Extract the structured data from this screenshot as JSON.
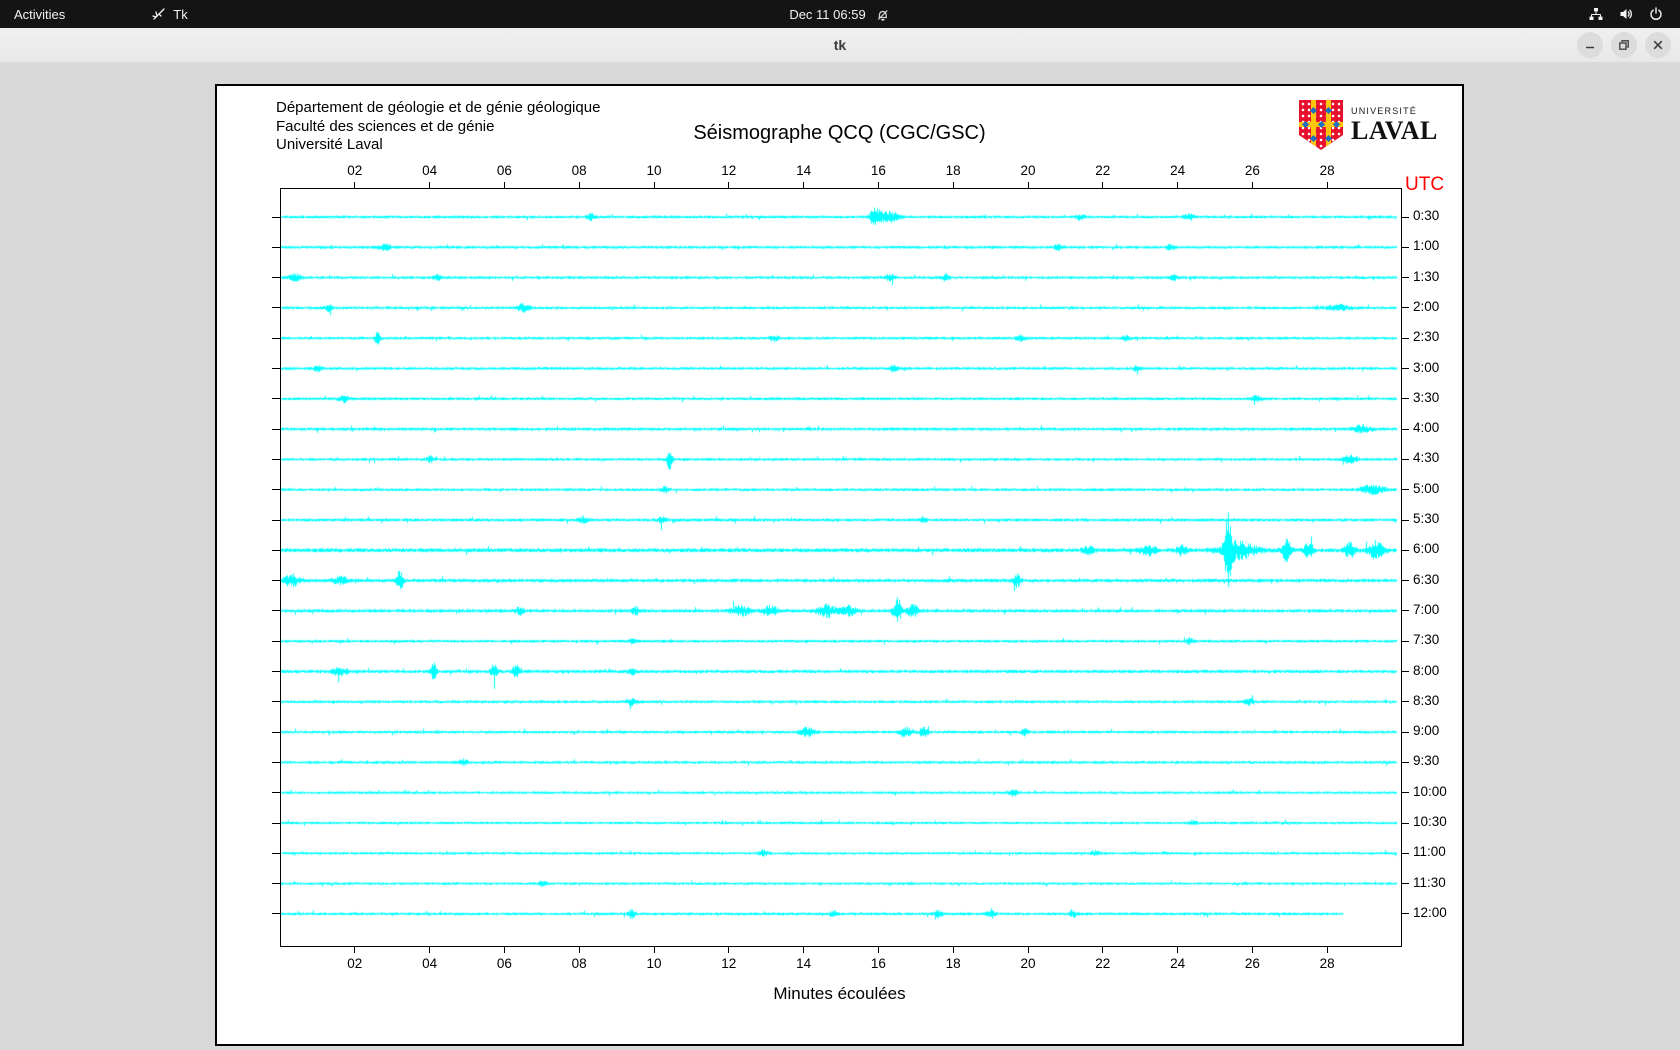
{
  "topbar": {
    "activities": "Activities",
    "app_label": "Tk",
    "clock": "Dec 11  06:59",
    "icons": [
      "tk-icon",
      "bell-muted-icon",
      "network-wired-icon",
      "volume-icon",
      "power-icon"
    ]
  },
  "titlebar": {
    "title": "tk",
    "buttons": [
      "minimize",
      "restore",
      "close"
    ]
  },
  "seismograph": {
    "org_lines": [
      "Département de géologie et de génie géologique",
      "Faculté des sciences et de génie",
      "Université Laval"
    ],
    "title": "Séismographe QCQ (CGC/GSC)",
    "logo": {
      "univ": "UNIVERSITÉ",
      "laval": "LAVAL"
    },
    "utc_label": "UTC",
    "xlabel": "Minutes écoulées",
    "chart_data": {
      "type": "line",
      "subtype": "seismogram-helicorder",
      "trace_color": "#00ffff",
      "x_range_minutes": [
        0,
        30
      ],
      "x_ticks": {
        "minutes": [
          2,
          4,
          6,
          8,
          10,
          12,
          14,
          16,
          18,
          20,
          22,
          24,
          26,
          28
        ],
        "labels": [
          "02",
          "04",
          "06",
          "08",
          "10",
          "12",
          "14",
          "16",
          "18",
          "20",
          "22",
          "24",
          "26",
          "28"
        ]
      },
      "rows": [
        {
          "label": "0:30",
          "base": 1.2,
          "events": [
            {
              "m": 15.9,
              "a": 7,
              "w": 0.12
            },
            {
              "m": 16.2,
              "a": 5,
              "w": 0.3
            },
            {
              "m": 8.3,
              "a": 2.5,
              "w": 0.1
            },
            {
              "m": 21.4,
              "a": 2.5,
              "w": 0.1
            },
            {
              "m": 24.3,
              "a": 2.5,
              "w": 0.12
            }
          ]
        },
        {
          "label": "1:00",
          "base": 1.2,
          "events": [
            {
              "m": 2.8,
              "a": 2.5,
              "w": 0.15
            },
            {
              "m": 20.8,
              "a": 2.5,
              "w": 0.12
            },
            {
              "m": 23.8,
              "a": 2,
              "w": 0.1
            }
          ]
        },
        {
          "label": "1:30",
          "base": 1.2,
          "events": [
            {
              "m": 0.4,
              "a": 3,
              "w": 0.15
            },
            {
              "m": 4.2,
              "a": 2.5,
              "w": 0.1
            },
            {
              "m": 16.3,
              "a": 2.5,
              "w": 0.12
            },
            {
              "m": 17.8,
              "a": 2.5,
              "w": 0.1
            },
            {
              "m": 23.9,
              "a": 2,
              "w": 0.1
            }
          ]
        },
        {
          "label": "2:00",
          "base": 1.2,
          "events": [
            {
              "m": 6.5,
              "a": 3.5,
              "w": 0.15
            },
            {
              "m": 1.3,
              "a": 2.5,
              "w": 0.1
            },
            {
              "m": 28.3,
              "a": 2.5,
              "w": 0.3
            }
          ]
        },
        {
          "label": "2:30",
          "base": 1.2,
          "events": [
            {
              "m": 2.6,
              "a": 7,
              "w": 0.06
            },
            {
              "m": 13.2,
              "a": 2.5,
              "w": 0.1
            },
            {
              "m": 19.8,
              "a": 2.5,
              "w": 0.12
            },
            {
              "m": 22.6,
              "a": 2,
              "w": 0.1
            }
          ]
        },
        {
          "label": "3:00",
          "base": 1.2,
          "events": [
            {
              "m": 1.0,
              "a": 2.5,
              "w": 0.1
            },
            {
              "m": 16.4,
              "a": 2.5,
              "w": 0.12
            },
            {
              "m": 22.9,
              "a": 2,
              "w": 0.1
            }
          ]
        },
        {
          "label": "3:30",
          "base": 1.2,
          "events": [
            {
              "m": 1.7,
              "a": 2.5,
              "w": 0.15
            },
            {
              "m": 26.1,
              "a": 2.5,
              "w": 0.12
            }
          ]
        },
        {
          "label": "4:00",
          "base": 1.3,
          "events": [
            {
              "m": 28.9,
              "a": 3,
              "w": 0.25
            }
          ]
        },
        {
          "label": "4:30",
          "base": 1.2,
          "events": [
            {
              "m": 10.4,
              "a": 8,
              "w": 0.07
            },
            {
              "m": 4.0,
              "a": 2.5,
              "w": 0.1
            },
            {
              "m": 28.6,
              "a": 3,
              "w": 0.2
            }
          ]
        },
        {
          "label": "5:00",
          "base": 1.2,
          "events": [
            {
              "m": 10.3,
              "a": 2.5,
              "w": 0.1
            },
            {
              "m": 29.2,
              "a": 4,
              "w": 0.3
            }
          ]
        },
        {
          "label": "5:30",
          "base": 1.3,
          "events": [
            {
              "m": 8.1,
              "a": 2.5,
              "w": 0.12
            },
            {
              "m": 10.2,
              "a": 2.5,
              "w": 0.1
            },
            {
              "m": 17.2,
              "a": 2,
              "w": 0.1
            }
          ]
        },
        {
          "label": "6:00",
          "base": 1.7,
          "events": [
            {
              "m": 21.6,
              "a": 3,
              "w": 0.15
            },
            {
              "m": 23.2,
              "a": 4,
              "w": 0.2
            },
            {
              "m": 24.1,
              "a": 4,
              "w": 0.15
            },
            {
              "m": 25.35,
              "a": 26,
              "w": 0.09
            },
            {
              "m": 25.6,
              "a": 7,
              "w": 0.5
            },
            {
              "m": 26.9,
              "a": 9,
              "w": 0.12
            },
            {
              "m": 27.5,
              "a": 6,
              "w": 0.12
            },
            {
              "m": 28.6,
              "a": 6,
              "w": 0.15
            },
            {
              "m": 29.3,
              "a": 7,
              "w": 0.2
            }
          ]
        },
        {
          "label": "6:30",
          "base": 1.5,
          "events": [
            {
              "m": 0.3,
              "a": 5,
              "w": 0.2
            },
            {
              "m": 1.6,
              "a": 3,
              "w": 0.2
            },
            {
              "m": 3.2,
              "a": 9,
              "w": 0.08
            },
            {
              "m": 19.7,
              "a": 5,
              "w": 0.1
            }
          ]
        },
        {
          "label": "7:00",
          "base": 1.4,
          "events": [
            {
              "m": 6.4,
              "a": 3,
              "w": 0.1
            },
            {
              "m": 9.5,
              "a": 3,
              "w": 0.1
            },
            {
              "m": 12.3,
              "a": 4,
              "w": 0.25
            },
            {
              "m": 13.1,
              "a": 4,
              "w": 0.2
            },
            {
              "m": 14.6,
              "a": 5,
              "w": 0.25
            },
            {
              "m": 15.2,
              "a": 4,
              "w": 0.2
            },
            {
              "m": 16.5,
              "a": 10,
              "w": 0.1
            },
            {
              "m": 16.9,
              "a": 5,
              "w": 0.15
            }
          ]
        },
        {
          "label": "7:30",
          "base": 1.2,
          "events": [
            {
              "m": 24.3,
              "a": 2.5,
              "w": 0.1
            },
            {
              "m": 9.4,
              "a": 2,
              "w": 0.1
            }
          ]
        },
        {
          "label": "8:00",
          "base": 1.4,
          "events": [
            {
              "m": 1.6,
              "a": 3,
              "w": 0.2
            },
            {
              "m": 4.1,
              "a": 7,
              "w": 0.08
            },
            {
              "m": 5.7,
              "a": 6,
              "w": 0.08
            },
            {
              "m": 6.3,
              "a": 5,
              "w": 0.1
            },
            {
              "m": 9.4,
              "a": 2.5,
              "w": 0.1
            }
          ]
        },
        {
          "label": "8:30",
          "base": 1.2,
          "events": [
            {
              "m": 9.4,
              "a": 3,
              "w": 0.12
            },
            {
              "m": 25.9,
              "a": 2.5,
              "w": 0.12
            }
          ]
        },
        {
          "label": "9:00",
          "base": 1.2,
          "events": [
            {
              "m": 14.1,
              "a": 3.5,
              "w": 0.2
            },
            {
              "m": 16.7,
              "a": 4.5,
              "w": 0.15
            },
            {
              "m": 17.2,
              "a": 3.5,
              "w": 0.12
            },
            {
              "m": 19.9,
              "a": 2.5,
              "w": 0.1
            }
          ]
        },
        {
          "label": "9:30",
          "base": 1.2,
          "events": [
            {
              "m": 4.9,
              "a": 2.5,
              "w": 0.12
            }
          ]
        },
        {
          "label": "10:00",
          "base": 1.1,
          "events": [
            {
              "m": 19.6,
              "a": 2.5,
              "w": 0.12
            }
          ]
        },
        {
          "label": "10:30",
          "base": 1.1,
          "events": [
            {
              "m": 24.4,
              "a": 2,
              "w": 0.1
            }
          ]
        },
        {
          "label": "11:00",
          "base": 1.1,
          "events": [
            {
              "m": 12.9,
              "a": 2.5,
              "w": 0.12
            },
            {
              "m": 21.8,
              "a": 2,
              "w": 0.1
            }
          ]
        },
        {
          "label": "11:30",
          "base": 1.1,
          "events": [
            {
              "m": 7.0,
              "a": 2,
              "w": 0.1
            }
          ]
        },
        {
          "label": "12:00",
          "base": 1.2,
          "end_min": 28.4,
          "events": [
            {
              "m": 9.4,
              "a": 4,
              "w": 0.08
            },
            {
              "m": 14.8,
              "a": 3,
              "w": 0.1
            },
            {
              "m": 17.6,
              "a": 3,
              "w": 0.1
            },
            {
              "m": 19.0,
              "a": 4,
              "w": 0.1
            },
            {
              "m": 21.2,
              "a": 2.5,
              "w": 0.1
            }
          ]
        }
      ]
    }
  },
  "colors": {
    "topbar_bg": "#141414",
    "titlebar_bg": "#ebebeb",
    "window_bg": "#d9d9d9",
    "image_bg": "#ffffff",
    "trace": "#00ffff",
    "utc_red": "#ff0000",
    "logo_red": "#e8112d",
    "logo_gold": "#ffc60a",
    "logo_blue": "#1d6fc4"
  }
}
